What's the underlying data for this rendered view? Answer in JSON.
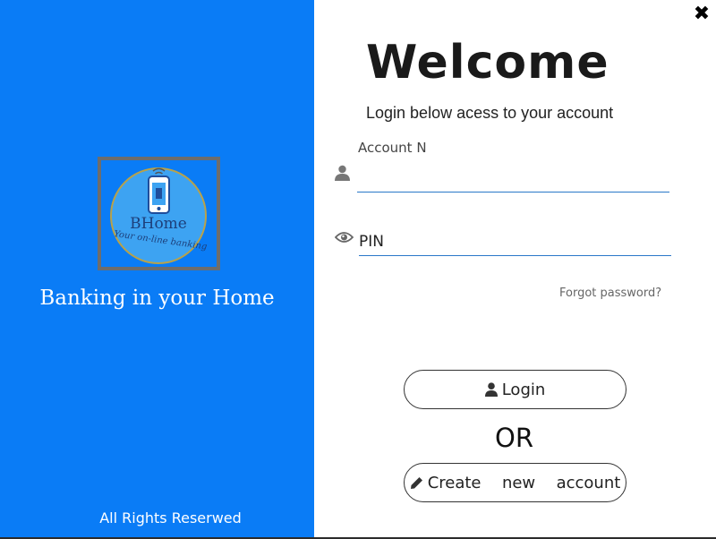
{
  "left_panel": {
    "brand_name": "BHome",
    "brand_slogan": "Your on-line banking",
    "tagline": "Banking in your Home",
    "footer": "All Rights Reserwed",
    "accent_color": "#0a7cf6"
  },
  "window": {
    "close_icon": "✖"
  },
  "login_form": {
    "title": "Welcome",
    "subtitle": "Login below acess to your account",
    "account_label": "Account N",
    "account_value": "",
    "pin_placeholder": "PIN",
    "forgot_password": "Forgot password?",
    "login_button": "Login",
    "or_text": "OR",
    "create_button": "Create  new  account"
  }
}
